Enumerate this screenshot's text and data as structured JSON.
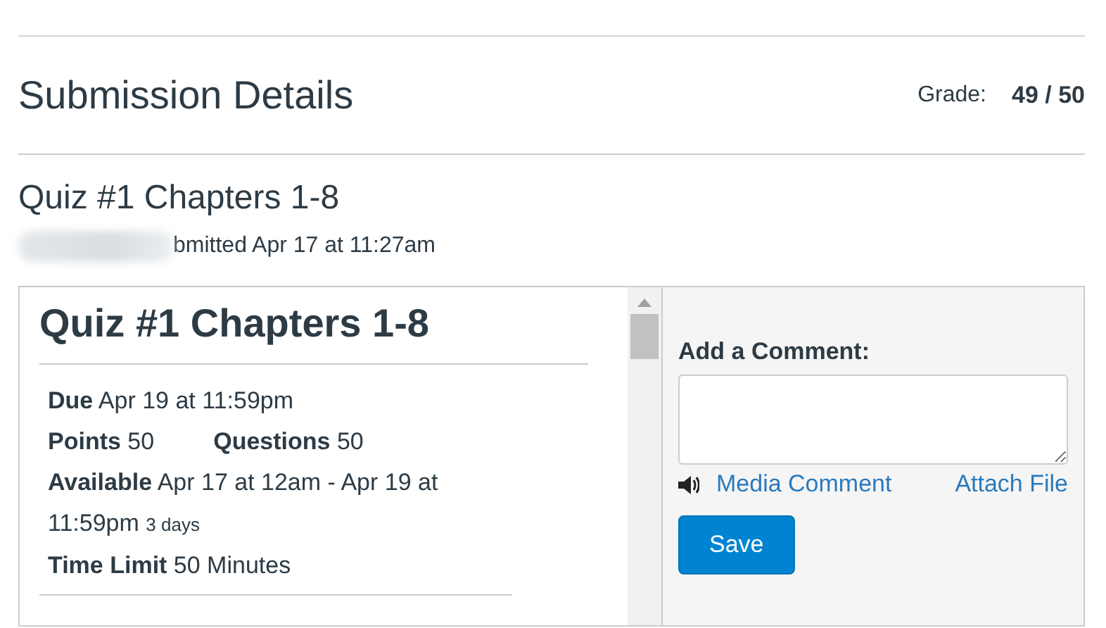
{
  "header": {
    "title": "Submission Details",
    "grade_label": "Grade:",
    "grade_value": "49 / 50"
  },
  "assignment": {
    "title": "Quiz #1 Chapters 1-8",
    "submitted": "bmitted Apr 17 at 11:27am"
  },
  "quiz": {
    "title": "Quiz #1 Chapters 1-8",
    "lines": [
      [
        {
          "text": "**Due** Apr 19 at 11:59pm"
        }
      ],
      [
        {
          "text": "**Points** 50"
        },
        {
          "text": "**Questions** 50"
        }
      ],
      [
        {
          "text": "**Available** Apr 17 at 12am - Apr 19 at 11:59pm",
          "note": "3 days"
        }
      ],
      [
        {
          "text": "**Time Limit** 50 Minutes"
        }
      ]
    ]
  },
  "comment": {
    "label": "Add a Comment:",
    "media_link": "Media Comment",
    "attach_link": "Attach File",
    "save_button": "Save"
  }
}
